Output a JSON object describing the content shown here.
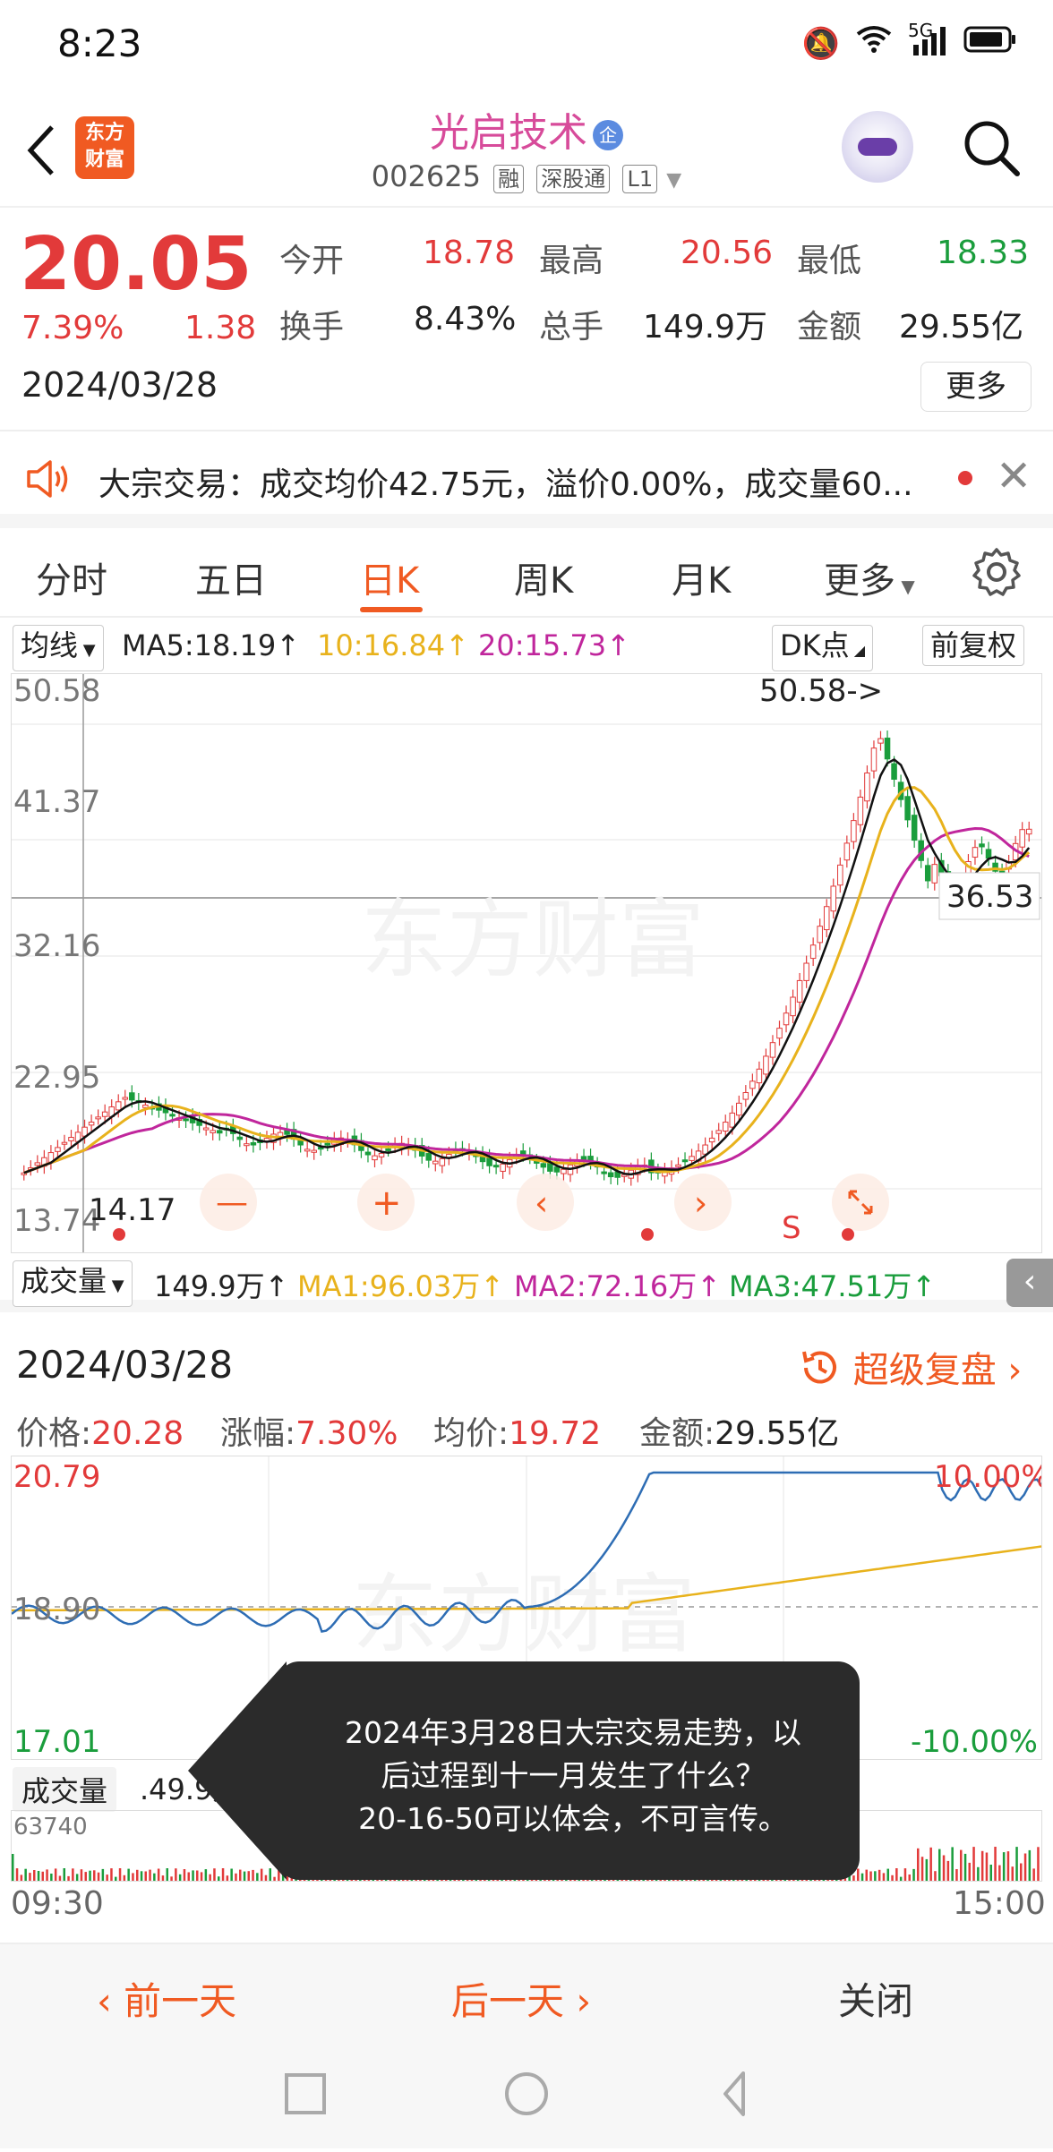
{
  "status": {
    "time": "8:23",
    "network": "5G"
  },
  "header": {
    "back_icon": "chevron-left-icon",
    "logo_line1": "东方",
    "logo_line2": "财富",
    "stock_name": "光启技术",
    "badge": "企",
    "code": "002625",
    "tags": [
      "融",
      "深股通",
      "L1"
    ]
  },
  "quote": {
    "price": "20.05",
    "change_pct": "7.39%",
    "change": "1.38",
    "date": "2024/03/28",
    "open_label": "今开",
    "open": "18.78",
    "high_label": "最高",
    "high": "20.56",
    "low_label": "最低",
    "low": "18.33",
    "turnover_label": "换手",
    "turnover": "8.43%",
    "volume_label": "总手",
    "volume": "149.9万",
    "amount_label": "金额",
    "amount": "29.55亿",
    "more_label": "更多"
  },
  "notice": {
    "text": "大宗交易：成交均价42.75元，溢价0.00%，成交量60..."
  },
  "tabs": {
    "items": [
      "分时",
      "五日",
      "日K",
      "周K",
      "月K",
      "更多"
    ],
    "active": "日K"
  },
  "ma": {
    "selector": "均线",
    "ma5": "MA5:18.19↑",
    "ma10": "10:16.84↑",
    "ma20": "20:15.73↑",
    "dk": "DK点",
    "adjust": "前复权"
  },
  "kchart": {
    "y_labels": [
      "50.58",
      "41.37",
      "32.16",
      "22.95",
      "13.74"
    ],
    "high_marker": "50.58->",
    "low_marker": "14.17",
    "current_label": "36.53",
    "watermark": "东方财富",
    "s_marker": "S"
  },
  "vol": {
    "selector": "成交量",
    "value": "149.9万↑",
    "ma1": "MA1:96.03万↑",
    "ma2": "MA2:72.16万↑",
    "ma3": "MA3:47.51万↑"
  },
  "panel": {
    "date": "2024/03/28",
    "replay": "超级复盘",
    "price_label": "价格:",
    "price": "20.28",
    "pct_label": "涨幅:",
    "pct": "7.30%",
    "avg_label": "均价:",
    "avg": "19.72",
    "amount_label": "金额:",
    "amount": "29.55亿",
    "y_top": "20.79",
    "y_mid": "18.90",
    "y_bottom": "17.01",
    "pct_top": "10.00%",
    "pct_bottom": "-10.00%",
    "vol_label": "成交量",
    "vol_value": ".49.9万",
    "vol_max": "63740",
    "time_start": "09:30",
    "time_end": "15:00",
    "watermark": "东方财富"
  },
  "tooltip": {
    "line1": "2024年3月28日大宗交易走势，以",
    "line2": "后过程到十一月发生了什么？",
    "line3": "20-16-50可以体会，不可言传。"
  },
  "bottom_nav": {
    "prev": "前一天",
    "next": "后一天",
    "close": "关闭"
  },
  "colors": {
    "up": "#e23a3a",
    "down": "#1a9d3c",
    "accent": "#f05a22",
    "ma10": "#e8b21c",
    "ma20": "#c0269c"
  }
}
